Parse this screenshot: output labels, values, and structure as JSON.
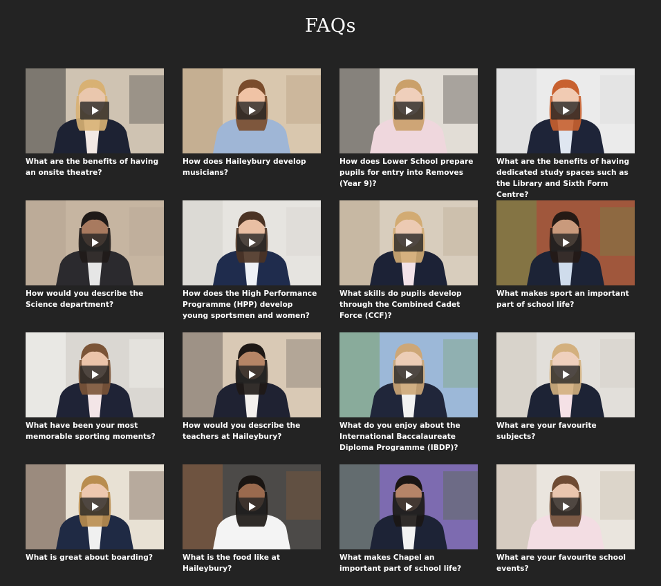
{
  "page": {
    "title": "FAQs",
    "background": "#232323"
  },
  "videos": [
    {
      "caption": "What are the benefits of having an onsite theatre?",
      "bg": "#cfc3b2",
      "bg2": "#3a3a3a",
      "skin": "#eac7ad",
      "hair": "#d8b173",
      "jacket": "#1d2233",
      "shirt": "#f3e9e4",
      "pos": "left"
    },
    {
      "caption": "How does Haileybury develop musicians?",
      "bg": "#d9c7ae",
      "bg2": "#b49a7c",
      "skin": "#f0c3a5",
      "hair": "#7a4c2c",
      "jacket": "#9fb6d6",
      "shirt": "#9fb6d6",
      "pos": "center"
    },
    {
      "caption": "How does Lower School prepare pupils for entry into Removes (Year 9)?",
      "bg": "#e2ddd6",
      "bg2": "#3b3733",
      "skin": "#efcfbb",
      "hair": "#caa06a",
      "jacket": "#efd7dd",
      "shirt": "#efd7dd",
      "pos": "center"
    },
    {
      "caption": "What are the benefits of having dedicated study spaces such as the Library and Sixth Form Centre?",
      "bg": "#ebebeb",
      "bg2": "#d8d8d8",
      "skin": "#f1cbb3",
      "hair": "#c8612f",
      "jacket": "#1e2438",
      "shirt": "#dfe6f0",
      "pos": "center"
    },
    {
      "caption": "How would you describe the Science department?",
      "bg": "#c6b5a1",
      "bg2": "#b4a391",
      "skin": "#a87a5f",
      "hair": "#1f1a18",
      "jacket": "#2b2a2e",
      "shirt": "#e6e6e6",
      "pos": "center"
    },
    {
      "caption": "How does the High Performance Programme (HPP) develop young sportsmen and women?",
      "bg": "#e6e4e0",
      "bg2": "#d4d1cc",
      "skin": "#e9bfa3",
      "hair": "#4b3324",
      "jacket": "#1f2c4d",
      "shirt": "#eef1f6",
      "pos": "center"
    },
    {
      "caption": "What skills do pupils develop through the Combined Cadet Force (CCF)?",
      "bg": "#d8cdbd",
      "bg2": "#b9a88e",
      "skin": "#eccab3",
      "hair": "#d2ab73",
      "jacket": "#1c2236",
      "shirt": "#f2e2e8",
      "pos": "center"
    },
    {
      "caption": "What makes sport an important part of school life?",
      "bg": "#a0573c",
      "bg2": "#6d8c4a",
      "skin": "#c99a7c",
      "hair": "#251a15",
      "jacket": "#1c2336",
      "shirt": "#cfdcec",
      "pos": "center"
    },
    {
      "caption": "What have been your most memorable sporting moments?",
      "bg": "#dad7d2",
      "bg2": "#f5f5f3",
      "skin": "#ebc4aa",
      "hair": "#7b5437",
      "jacket": "#1f2336",
      "shirt": "#f3e5e7",
      "pos": "center"
    },
    {
      "caption": "How would you describe the teachers at Haileybury?",
      "bg": "#d9c9b5",
      "bg2": "#6d655e",
      "skin": "#b68566",
      "hair": "#1e1815",
      "jacket": "#1f2232",
      "shirt": "#f4f1ee",
      "pos": "center"
    },
    {
      "caption": "What do you enjoy about the International Baccalaureate Diploma Programme (IBDP)?",
      "bg": "#9cb8d8",
      "bg2": "#7aa06a",
      "skin": "#eccdb6",
      "hair": "#cda777",
      "jacket": "#20263a",
      "shirt": "#f2f2f2",
      "pos": "center"
    },
    {
      "caption": "What are your favourite subjects?",
      "bg": "#e2dfda",
      "bg2": "#cfc9c0",
      "skin": "#efd0bd",
      "hair": "#d3b07e",
      "jacket": "#1d2335",
      "shirt": "#f5e1e6",
      "pos": "center"
    },
    {
      "caption": "What is great about boarding?",
      "bg": "#e8e1d4",
      "bg2": "#5b4637",
      "skin": "#eec8af",
      "hair": "#b98d4f",
      "jacket": "#1f2a44",
      "shirt": "#f0f0f0",
      "pos": "center"
    },
    {
      "caption": "What is the food like at Haileybury?",
      "bg": "#4c4a48",
      "bg2": "#8a5b3a",
      "skin": "#9a6a4e",
      "hair": "#1a1512",
      "jacket": "#f4f4f4",
      "shirt": "#f4f4f4",
      "pos": "center"
    },
    {
      "caption": "What makes Chapel an important part of school life?",
      "bg": "#7d6bb0",
      "bg2": "#4f6d3a",
      "skin": "#b58468",
      "hair": "#1b1614",
      "jacket": "#1d2336",
      "shirt": "#f2f2f2",
      "pos": "center"
    },
    {
      "caption": "What are your favourite school events?",
      "bg": "#eae5de",
      "bg2": "#c2b6a7",
      "skin": "#eac6ae",
      "hair": "#6f4b33",
      "jacket": "#f3dde3",
      "shirt": "#f3dde3",
      "pos": "center"
    }
  ]
}
